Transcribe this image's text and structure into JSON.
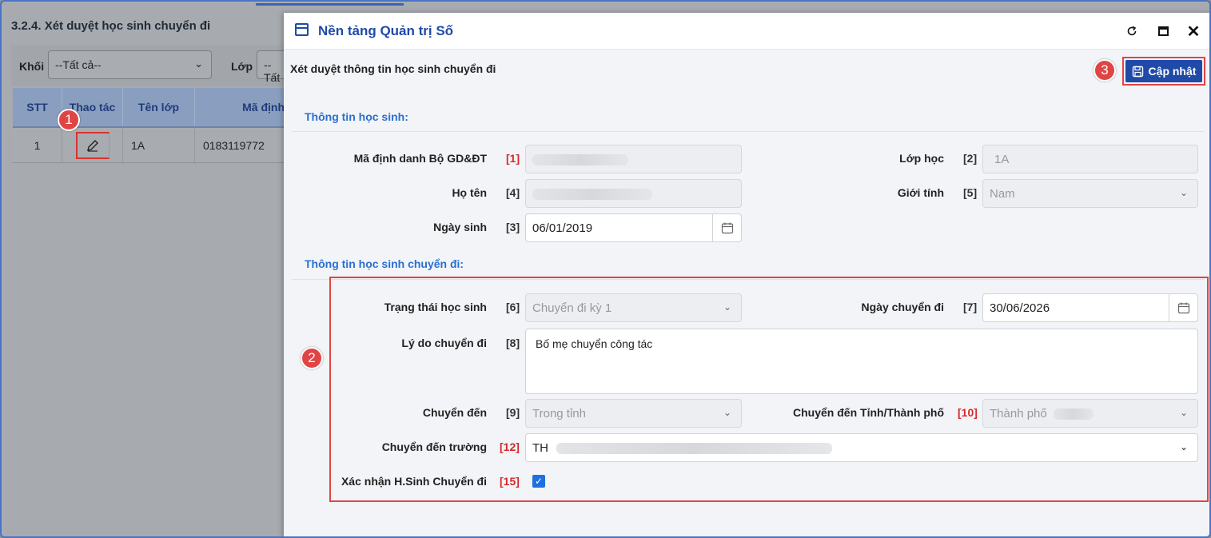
{
  "background": {
    "page_title": "3.2.4. Xét duyệt học sinh chuyển đi",
    "filter_khoi_label": "Khối",
    "filter_khoi_value": "--Tất cả--",
    "filter_lop_label": "Lớp",
    "filter_lop_value": "--Tất",
    "table": {
      "headers": [
        "STT",
        "Thao tác",
        "Tên lớp",
        "Mã định"
      ],
      "row": {
        "stt": "1",
        "class": "1A",
        "code": "0183119772"
      }
    }
  },
  "steps": {
    "one": "1",
    "two": "2",
    "three": "3"
  },
  "dialog": {
    "title": "Nền tảng Quản trị Số",
    "subtitle": "Xét duyệt thông tin học sinh chuyển đi",
    "save_label": "Cập nhật",
    "section1": "Thông tin học sinh:",
    "section2": "Thông tin học sinh chuyển đi:",
    "fields": {
      "ma_dinh_danh": {
        "label": "Mã định danh Bộ GD&ĐT",
        "index": "[1]"
      },
      "lop_hoc": {
        "label": "Lớp học",
        "index": "[2]",
        "value": "1A"
      },
      "ho_ten": {
        "label": "Họ tên",
        "index": "[4]"
      },
      "gioi_tinh": {
        "label": "Giới tính",
        "index": "[5]",
        "value": "Nam"
      },
      "ngay_sinh": {
        "label": "Ngày sinh",
        "index": "[3]",
        "value": "06/01/2019"
      },
      "trang_thai": {
        "label": "Trạng thái học sinh",
        "index": "[6]",
        "value": "Chuyển đi kỳ 1"
      },
      "ngay_chuyen_di": {
        "label": "Ngày chuyển đi",
        "index": "[7]",
        "value": "30/06/2026"
      },
      "ly_do": {
        "label": "Lý do chuyển đi",
        "index": "[8]",
        "value": "Bố mẹ chuyển công tác"
      },
      "chuyen_den": {
        "label": "Chuyển đến",
        "index": "[9]",
        "value": "Trong tỉnh"
      },
      "chuyen_den_tinh": {
        "label": "Chuyển đến Tỉnh/Thành phố",
        "index": "[10]",
        "value": "Thành phố"
      },
      "chuyen_den_truong": {
        "label": "Chuyển đến trường",
        "index": "[12]",
        "value": "TH"
      },
      "xac_nhan": {
        "label": "Xác nhận H.Sinh Chuyển đi",
        "index": "[15]",
        "checked": true
      }
    }
  },
  "colors": {
    "primary": "#1f4aa8",
    "accent_red": "#e04545",
    "section_blue": "#2a6fd0"
  }
}
